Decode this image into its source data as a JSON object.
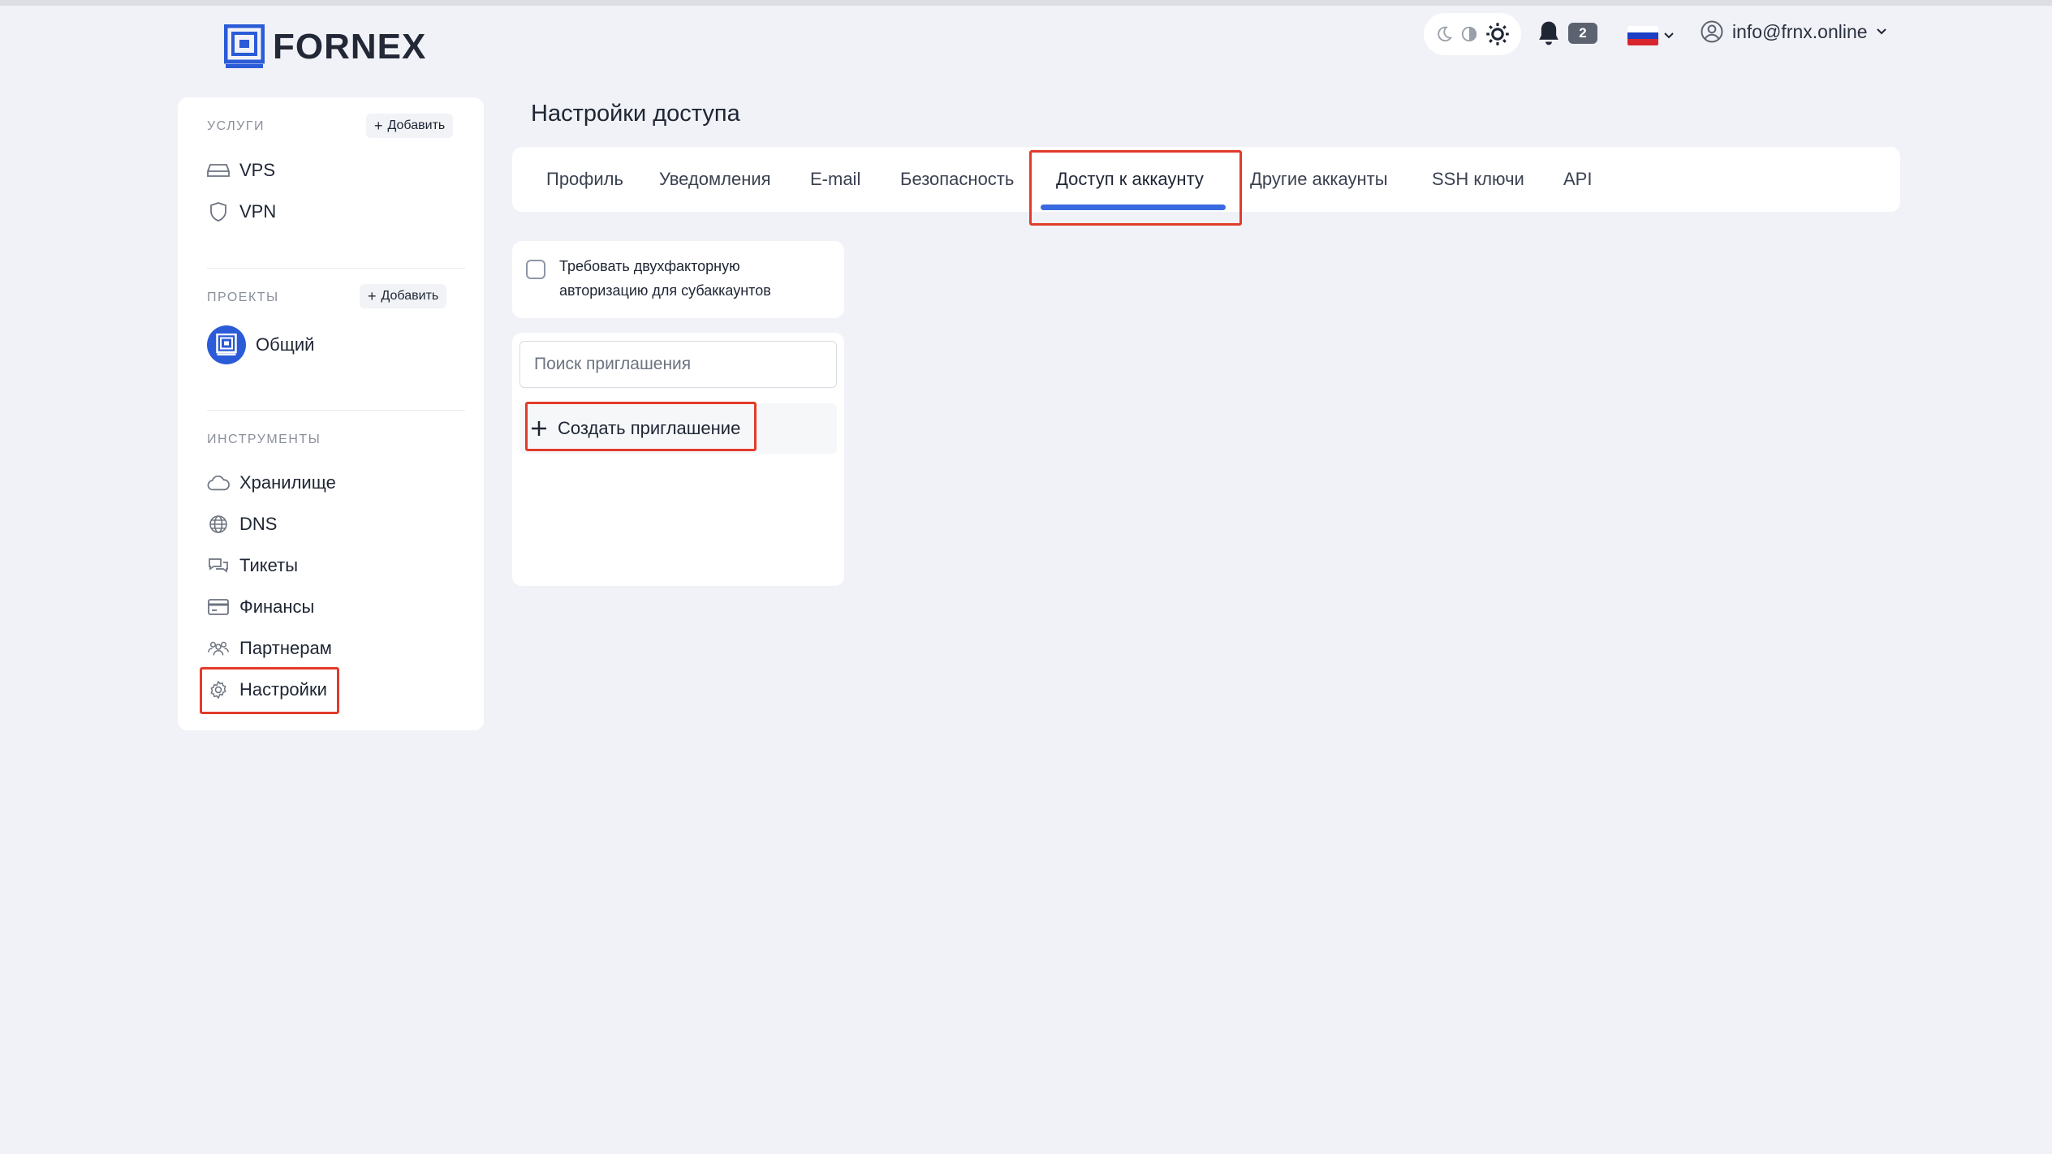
{
  "header": {
    "logo_text": "FORNEX",
    "notifications_count": "2",
    "user_email": "info@frnx.online",
    "language": "ru"
  },
  "sidebar": {
    "services": {
      "title": "УСЛУГИ",
      "add_label": "Добавить",
      "items": [
        {
          "label": "VPS",
          "icon": "server-icon"
        },
        {
          "label": "VPN",
          "icon": "shield-icon"
        }
      ]
    },
    "projects": {
      "title": "ПРОЕКТЫ",
      "add_label": "Добавить",
      "items": [
        {
          "label": "Общий",
          "icon": "project-logo-icon"
        }
      ]
    },
    "tools": {
      "title": "ИНСТРУМЕНТЫ",
      "items": [
        {
          "label": "Хранилище",
          "icon": "cloud-icon"
        },
        {
          "label": "DNS",
          "icon": "globe-icon"
        },
        {
          "label": "Тикеты",
          "icon": "chat-icon"
        },
        {
          "label": "Финансы",
          "icon": "credit-card-icon"
        },
        {
          "label": "Партнерам",
          "icon": "people-icon"
        },
        {
          "label": "Настройки",
          "icon": "gear-icon"
        }
      ]
    }
  },
  "main": {
    "title": "Настройки доступа",
    "tabs": [
      {
        "label": "Профиль"
      },
      {
        "label": "Уведомления"
      },
      {
        "label": "E-mail"
      },
      {
        "label": "Безопасность"
      },
      {
        "label": "Доступ к аккаунту",
        "active": true
      },
      {
        "label": "Другие аккаунты"
      },
      {
        "label": "SSH ключи"
      },
      {
        "label": "API"
      }
    ],
    "require_2fa_label": "Требовать двухфакторную авторизацию для субаккаунтов",
    "require_2fa_checked": false,
    "search": {
      "placeholder": "Поиск приглашения",
      "value": ""
    },
    "create_invite_label": "Создать приглашение"
  },
  "colors": {
    "accent": "#2b5bd7",
    "highlight": "#e23b2a",
    "background": "#f1f2f7"
  }
}
